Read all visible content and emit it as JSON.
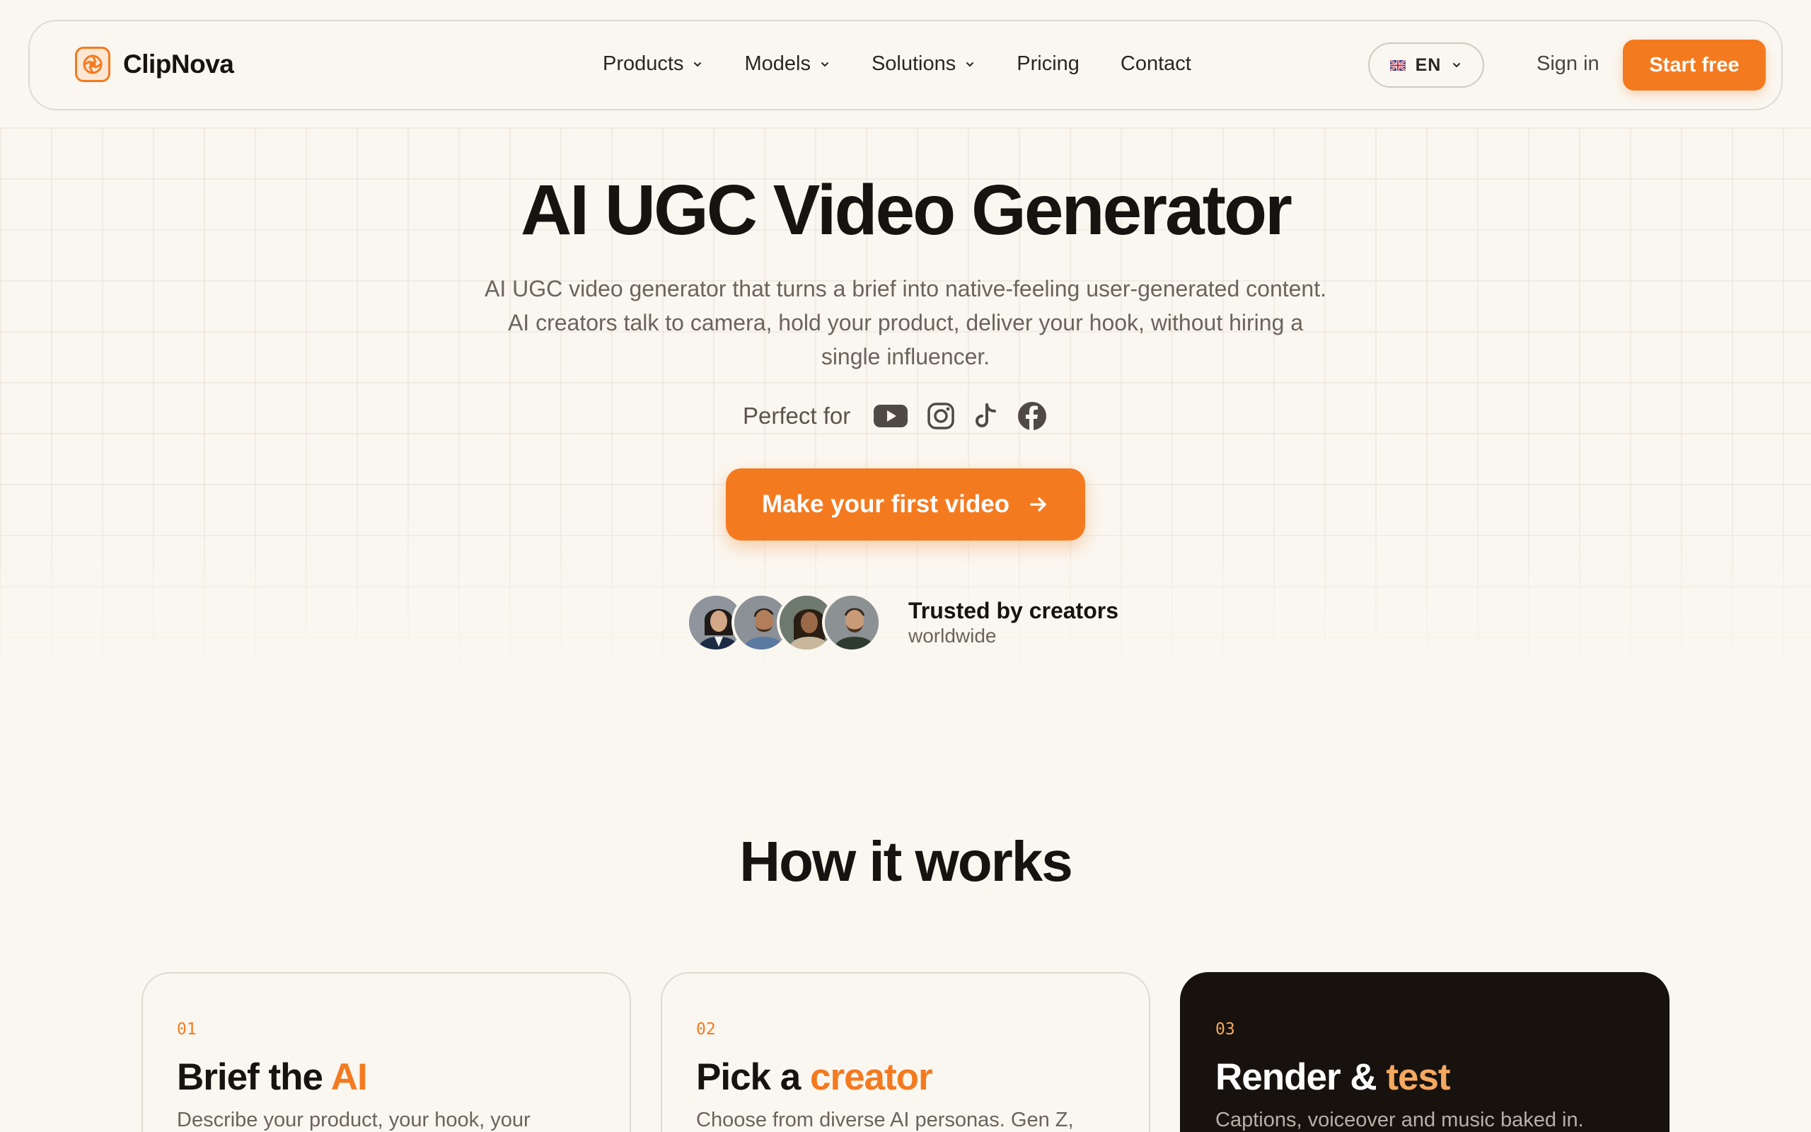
{
  "brand": {
    "name": "ClipNova",
    "icon": "aperture-icon",
    "accent": "#f47a20"
  },
  "nav": {
    "items": [
      {
        "label": "Products",
        "dropdown": true
      },
      {
        "label": "Models",
        "dropdown": true
      },
      {
        "label": "Solutions",
        "dropdown": true
      },
      {
        "label": "Pricing",
        "dropdown": false
      },
      {
        "label": "Contact",
        "dropdown": false
      }
    ],
    "language": {
      "code": "EN",
      "flag": "uk-flag-icon"
    },
    "sign_in": "Sign in",
    "start_free": "Start free"
  },
  "hero": {
    "title": "AI UGC Video Generator",
    "subtitle": "AI UGC video generator that turns a brief into native-feeling user-generated content. AI creators talk to camera, hold your product, deliver your hook, without hiring a single influencer.",
    "perfect_for": "Perfect for",
    "platforms": [
      "youtube-icon",
      "instagram-icon",
      "tiktok-icon",
      "facebook-icon"
    ],
    "cta": "Make your first video",
    "trusted_title": "Trusted by creators",
    "trusted_sub": "worldwide"
  },
  "how": {
    "title": "How it works",
    "steps": [
      {
        "num": "01",
        "title_a": "Brief the ",
        "title_b": "AI",
        "body": "Describe your product, your hook, your",
        "dark": false
      },
      {
        "num": "02",
        "title_a": "Pick a ",
        "title_b": "creator",
        "body": "Choose from diverse AI personas. Gen Z,",
        "dark": false
      },
      {
        "num": "03",
        "title_a": "Render & ",
        "title_b": "test",
        "body": "Captions, voiceover and music baked in.",
        "dark": true
      }
    ]
  }
}
